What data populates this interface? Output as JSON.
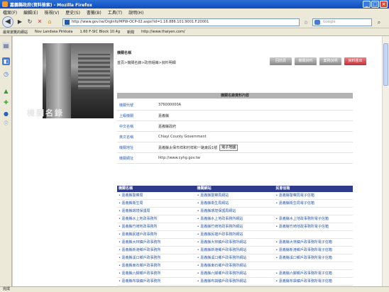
{
  "window": {
    "title": "嘉義縣政府(資料檢索) - Mozilla Firefox"
  },
  "menubar": [
    "檔案(F)",
    "編輯(E)",
    "檢視(V)",
    "歷史(S)",
    "書籤(B)",
    "工具(T)",
    "說明(H)"
  ],
  "navbar": {
    "url": "http://www.gov.tw/OrgInfo/MPW-OCP-02.aspx?id=1.16.886.101.9001.F.20001",
    "search_placeholder": "Google"
  },
  "bookmarks": [
    "最常瀏覽的網站",
    "Nov Landsea Pirkkala",
    "1.60 F-SIC Block 10.4g",
    "新聞",
    "http://www.thaiyen.com/"
  ],
  "page": {
    "site_title": "機關名稱",
    "breadcrumb": "首頁>機關名錄>政府組織>資料明細",
    "banner_logo": "機關名錄",
    "top_buttons": [
      "回前頁",
      "機關資料",
      "業務說明",
      "資料匯出"
    ],
    "panel_title": "機關名錄資料內容",
    "info_rows": [
      {
        "label": "機關代號",
        "value": "376000000A"
      },
      {
        "label": "上級機關",
        "value": "嘉義縣"
      },
      {
        "label": "中文名稱",
        "value": "嘉義縣政府"
      },
      {
        "label": "英文名稱",
        "value": "Chiayi County Government"
      },
      {
        "label": "機關地址",
        "value": "嘉義縣太保市祥和村祥和一路東段1號",
        "button": "電子地圖"
      },
      {
        "label": "機關網址",
        "value": "http://www.cyhg.gov.tw"
      }
    ],
    "links_headers": [
      "機關名稱",
      "機關網站",
      "民意信箱"
    ],
    "links_rows": [
      [
        "嘉義縣警察局",
        "嘉義縣警察局網站",
        "嘉義縣警察局電子信箱"
      ],
      [
        "嘉義縣衛生局",
        "嘉義縣衛生局網站",
        "嘉義縣衛生局電子信箱"
      ],
      [
        "嘉義縣環境保護局",
        "嘉義縣環境保護局網站",
        ""
      ],
      [
        "嘉義縣水上地政事務所",
        "嘉義縣水上地政事務所網站",
        "嘉義縣水上地政事務所電子信箱"
      ],
      [
        "嘉義縣竹崎地政事務所",
        "嘉義縣竹崎地政事務所網站",
        "嘉義縣竹崎地政事務所電子信箱"
      ],
      [
        "嘉義縣民雄戶政事務所",
        "嘉義縣民雄戶政事務所網站",
        ""
      ],
      [
        "嘉義縣大林鎮戶政事務所",
        "嘉義縣大林鎮戶政事務所網站",
        "嘉義縣大林鎮戶政事務所電子信箱"
      ],
      [
        "嘉義縣新港鄉戶政事務所",
        "嘉義縣新港鄉戶政事務所網站",
        "嘉義縣新港鄉戶政事務所電子信箱"
      ],
      [
        "嘉義縣溪口鄉戶政事務所",
        "嘉義縣溪口鄉戶政事務所網站",
        "嘉義縣溪口鄉戶政事務所電子信箱"
      ],
      [
        "嘉義縣東石鄉戶政事務所",
        "嘉義縣東石鄉戶政事務所網站",
        ""
      ],
      [
        "嘉義縣六腳鄉戶政事務所",
        "嘉義縣六腳鄉戶政事務所網站",
        "嘉義縣六腳鄉戶政事務所電子信箱"
      ],
      [
        "嘉義縣布袋鎮戶政事務所",
        "嘉義縣布袋鎮戶政事務所網站",
        "嘉義縣布袋鎮戶政事務所電子信箱"
      ],
      [
        "嘉義縣義竹鄉戶政事務所",
        "嘉義縣義竹鄉戶政事務所網站",
        "嘉義縣義竹鄉戶政事務所電子信箱"
      ],
      [
        "嘉義縣水上鄉戶政事務所",
        "嘉義縣水上鄉戶政事務所網站",
        "嘉義縣水上鄉戶政事務所電子信箱"
      ]
    ]
  },
  "statusbar": {
    "text": "完成"
  },
  "colors": {
    "title_bar": "#0e4cbc",
    "links_header": "#2e3a8c",
    "link_text": "#2d5aa8",
    "accent_red": "#c0303a"
  }
}
